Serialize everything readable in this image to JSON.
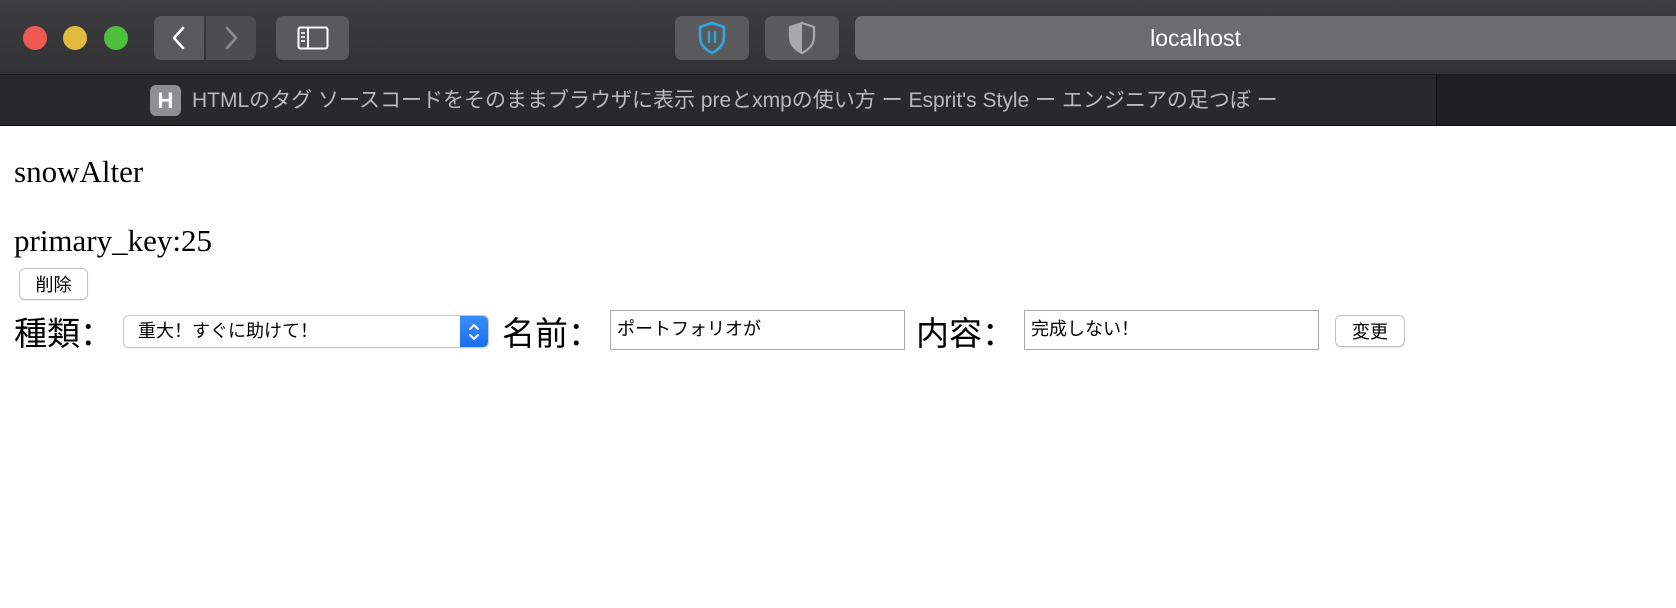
{
  "browser": {
    "address": "localhost",
    "tab": {
      "favicon_letter": "H",
      "title": "HTMLのタグ ソースコードをそのままブラウザに表示 preとxmpの使い方 ー Esprit's Style ー エンジニアの足つぼ ー"
    },
    "icons": {
      "close": "close-window",
      "minimize": "minimize-window",
      "zoom": "zoom-window",
      "back": "chevron-left-icon",
      "forward": "chevron-right-icon",
      "sidebar": "sidebar-icon",
      "extension_one": "shield-pause-icon",
      "extension_two": "shield-half-icon"
    },
    "colors": {
      "close": "#ee5a52",
      "minimize": "#e1b93c",
      "zoom": "#4fbe3f",
      "extension_accent": "#2fa8e0",
      "select_accent": "#1b6ff2"
    }
  },
  "page": {
    "heading": "snowAlter",
    "primary_key_text": "primary_key:25",
    "delete_label": "削除",
    "form": {
      "kind_label": "種類：",
      "kind_selected": "重大！すぐに助けて！",
      "name_label": "名前：",
      "name_value": "ポートフォリオが",
      "content_label": "内容：",
      "content_value": "完成しない！",
      "submit_label": "変更"
    }
  }
}
